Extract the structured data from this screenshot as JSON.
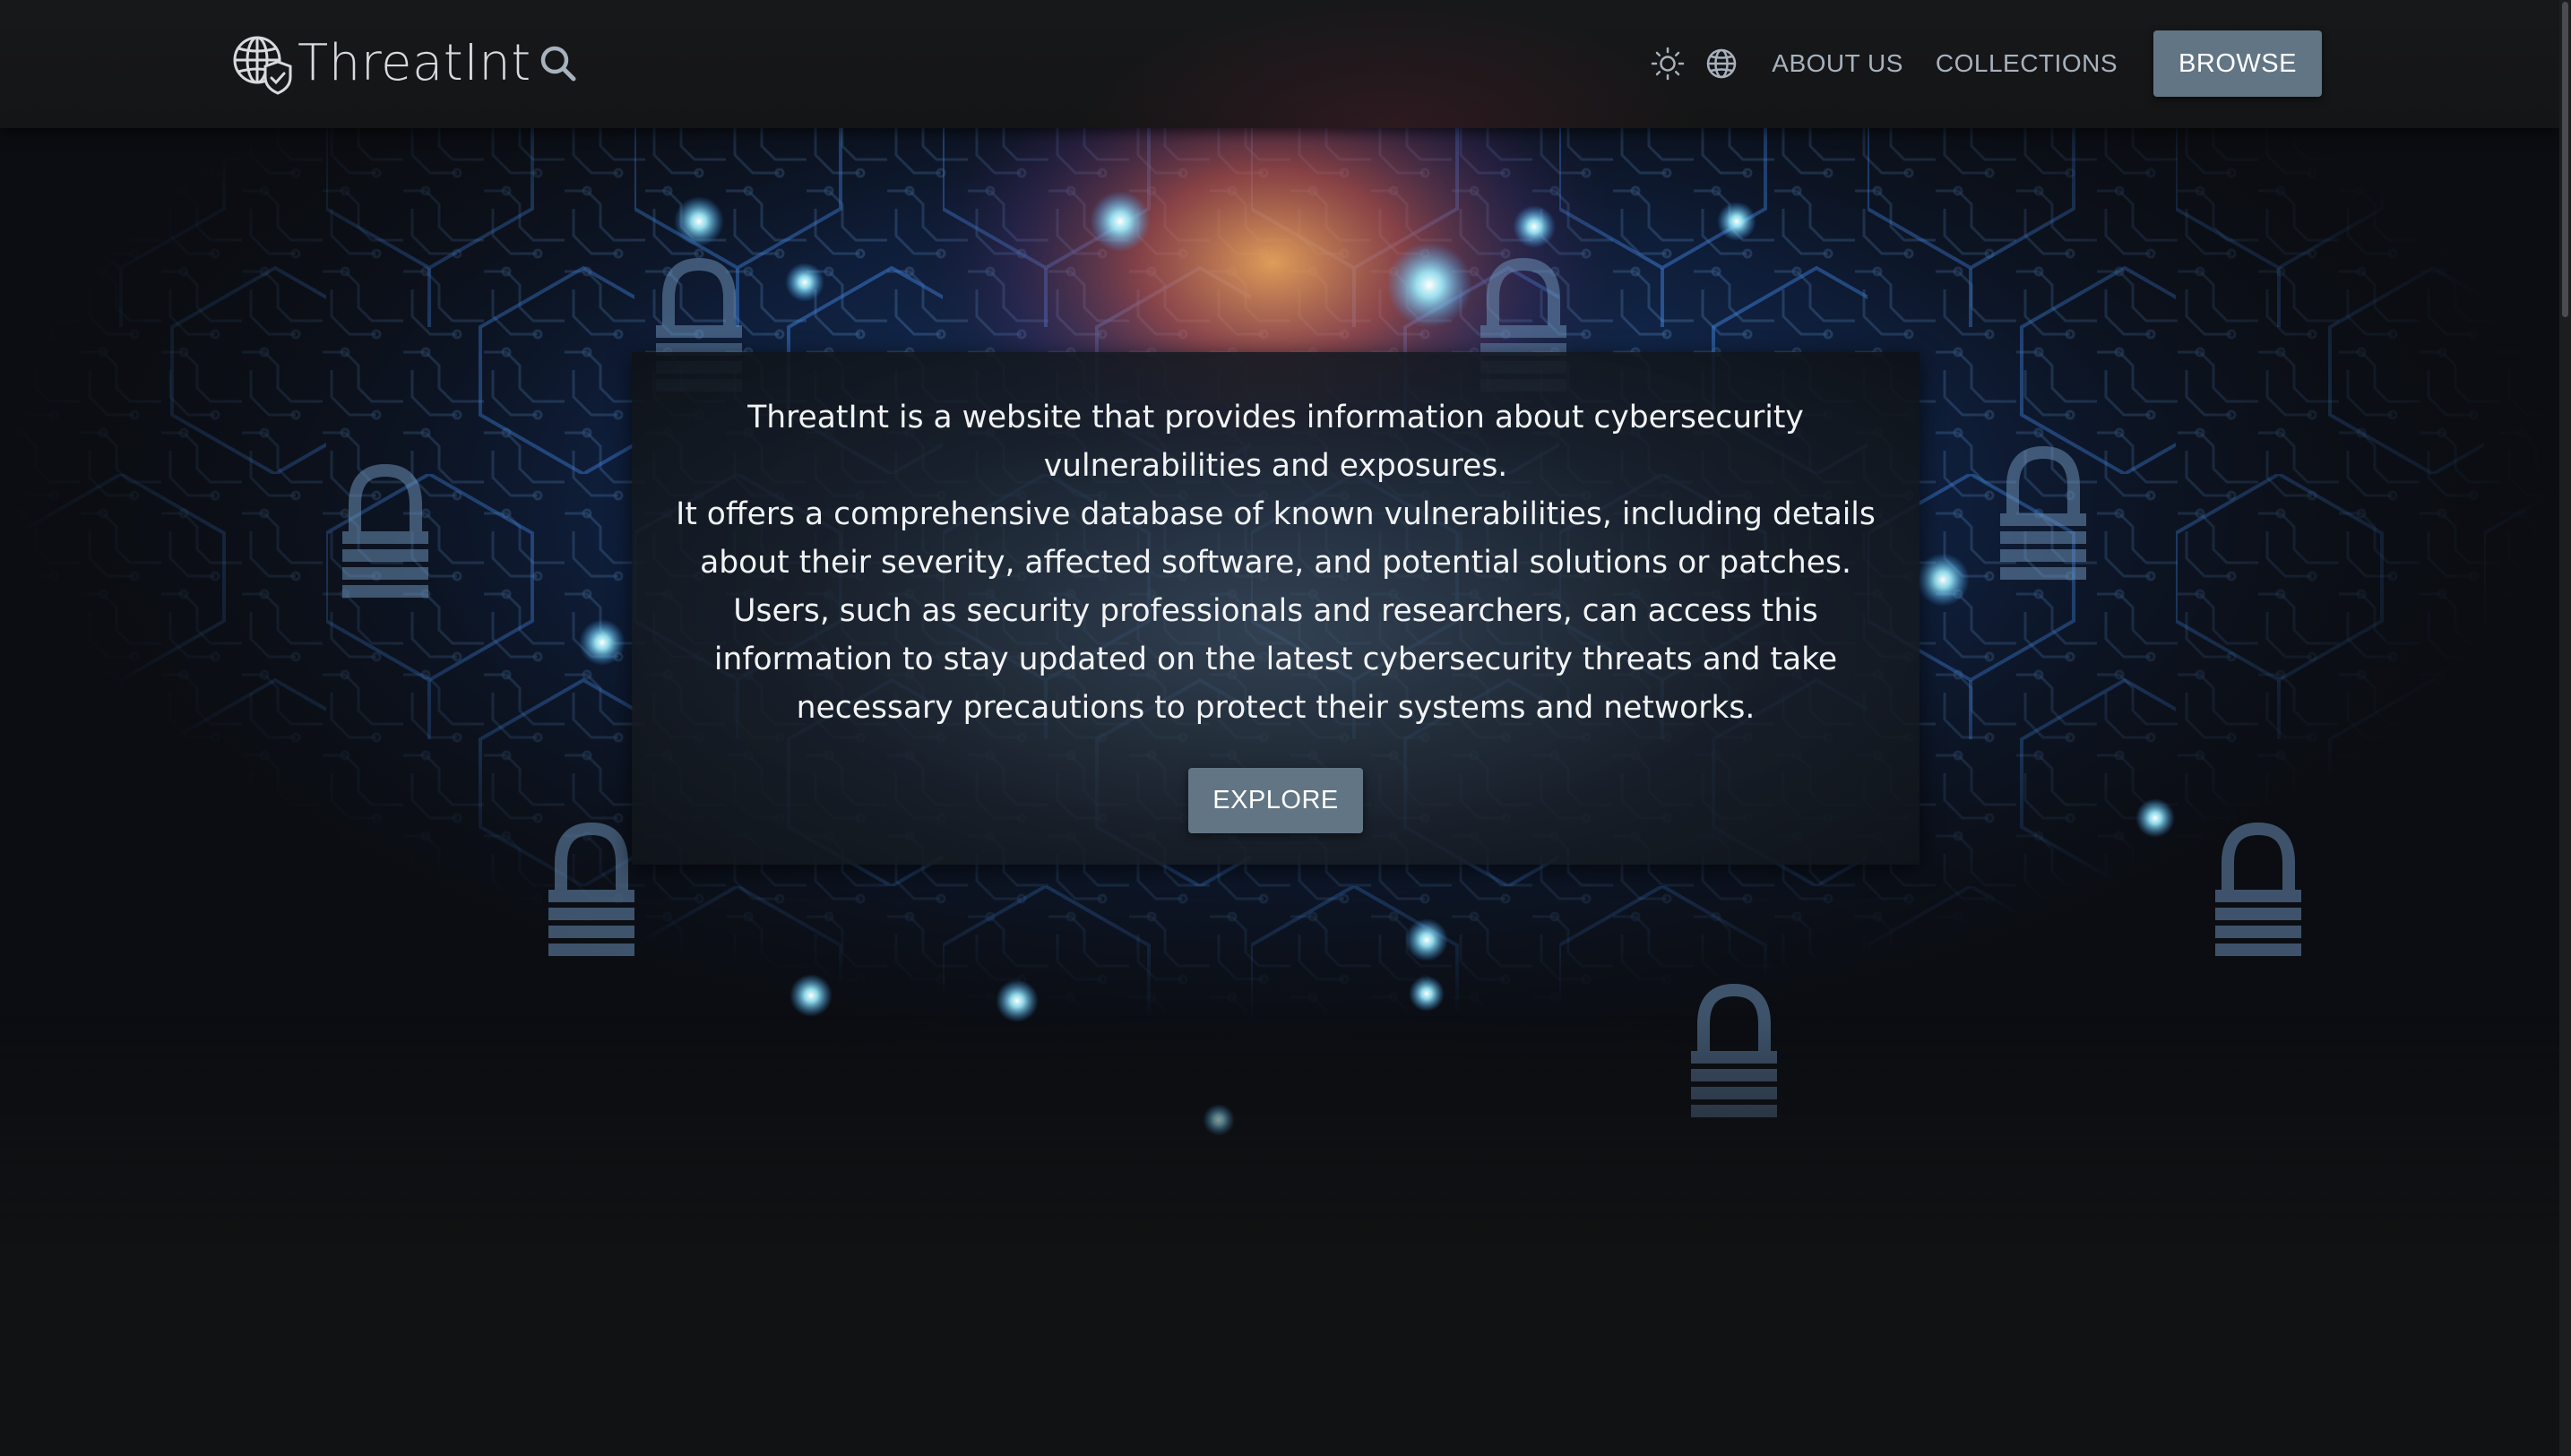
{
  "header": {
    "brand": "ThreatInt",
    "logo_icon": "globe-shield-icon",
    "search_icon": "search-icon",
    "theme_icon": "sun-icon",
    "language_icon": "globe-icon",
    "nav": {
      "about_label": "ABOUT US",
      "collections_label": "COLLECTIONS",
      "browse_label": "BROWSE"
    }
  },
  "hero": {
    "paragraphs": [
      "ThreatInt is a website that provides information about cybersecurity vulnerabilities and exposures.",
      "It offers a comprehensive database of known vulnerabilities, including details about their severity, affected software, and potential solutions or patches.",
      "Users, such as security professionals and researchers, can access this information to stay updated on the latest cybersecurity threats and take necessary precautions to protect their systems and networks."
    ],
    "explore_label": "EXPLORE"
  },
  "colors": {
    "background": "#111213",
    "header": "#17181a",
    "button": "#627585",
    "nav_text": "#a7b2bd",
    "hex_line": "#3f7fd6",
    "glow": "#8fe9ff"
  }
}
